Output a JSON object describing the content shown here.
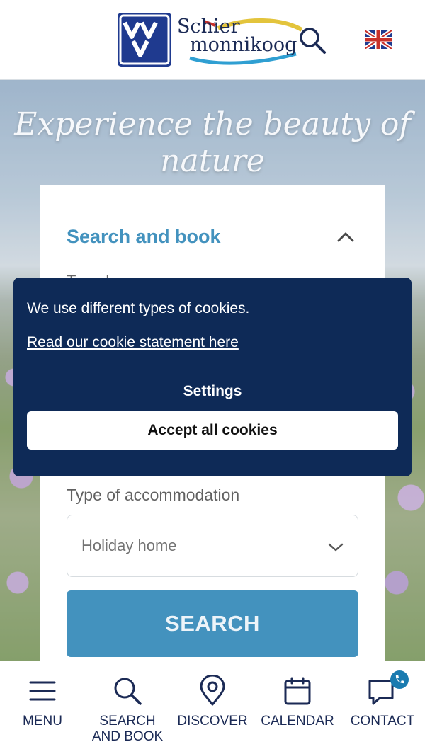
{
  "header": {
    "logo": {
      "letters": "VVV",
      "brand_line1": "Schier",
      "brand_line2": "monnikoog"
    },
    "search_icon": "search-icon",
    "language_icon": "uk-flag-icon"
  },
  "hero": {
    "title": "Experience the beauty of nature"
  },
  "search_card": {
    "title": "Search and book",
    "subtitle_partial": "Travel",
    "accommodation_label": "Type of accommodation",
    "accommodation_value": "Holiday home",
    "search_button": "SEARCH"
  },
  "cookie_banner": {
    "text": "We use different types of cookies.",
    "link": "Read our cookie statement here",
    "settings": "Settings",
    "accept": "Accept all cookies"
  },
  "bottom_nav": {
    "items": [
      {
        "label": "MENU",
        "icon": "hamburger-menu-icon"
      },
      {
        "label": "SEARCH AND BOOK",
        "icon": "search-icon"
      },
      {
        "label": "DISCOVER",
        "icon": "map-pin-icon"
      },
      {
        "label": "CALENDAR",
        "icon": "calendar-icon"
      },
      {
        "label": "CONTACT",
        "icon": "chat-bubble-icon"
      }
    ]
  },
  "colors": {
    "primary_blue": "#1a7bb0",
    "navy": "#0e2a57",
    "logo_blue": "#1f3a8f"
  }
}
